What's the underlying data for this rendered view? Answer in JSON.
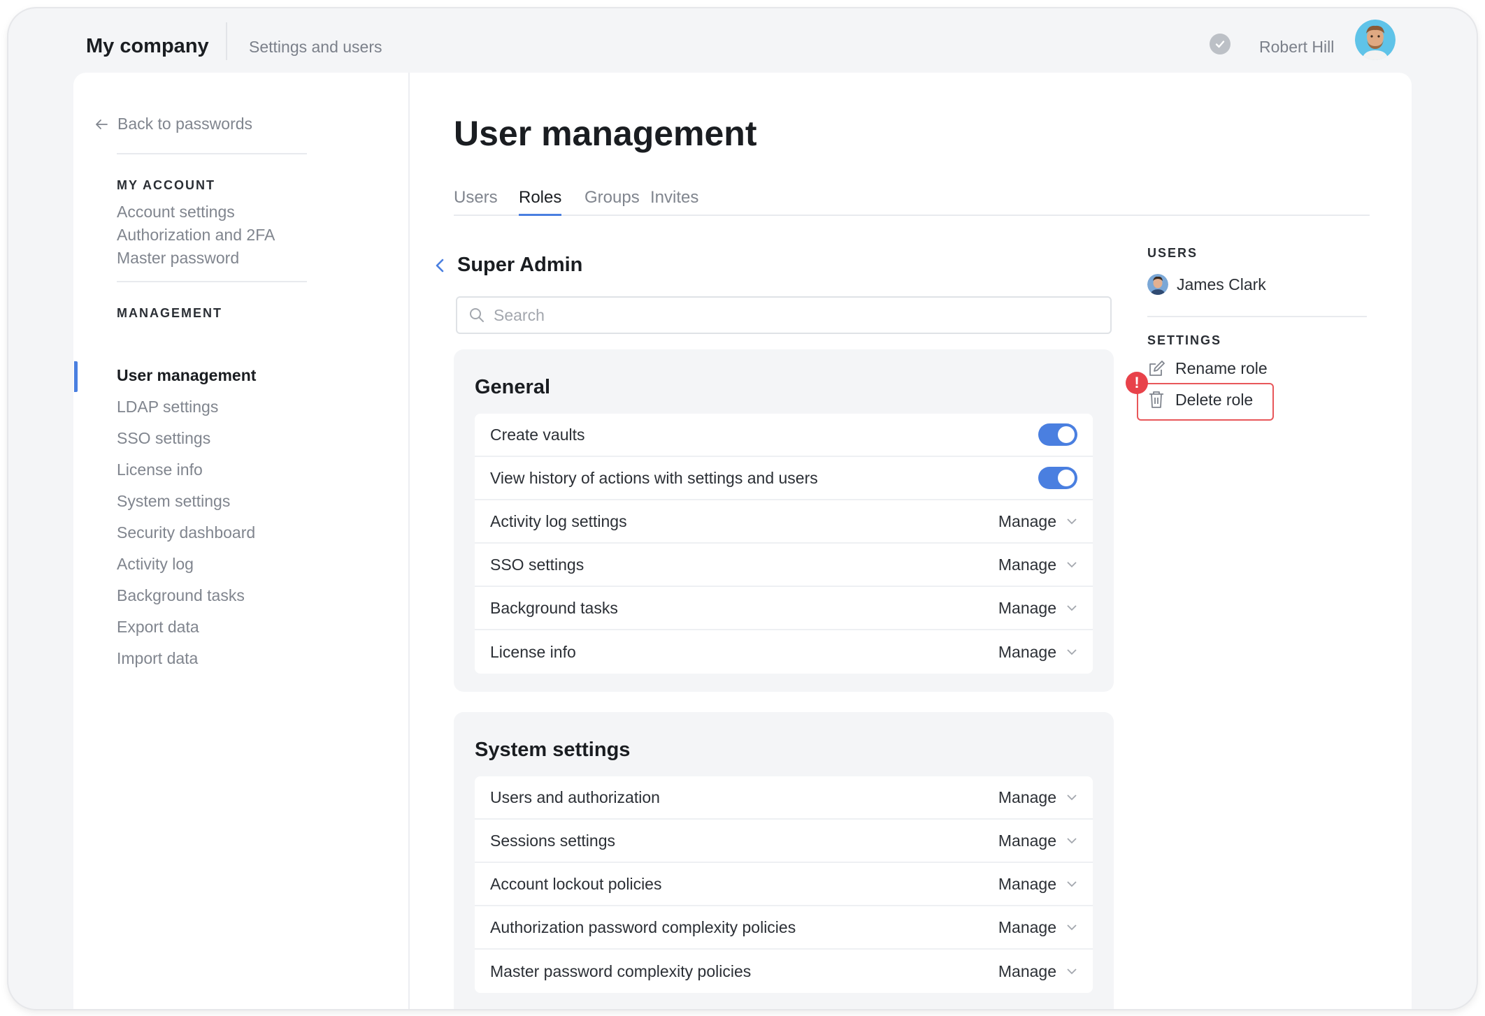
{
  "header": {
    "brand": "My company",
    "breadcrumb": "Settings and users",
    "user_name": "Robert Hill"
  },
  "sidebar": {
    "back_label": "Back to passwords",
    "my_account_title": "MY ACCOUNT",
    "my_account_items": [
      "Account settings",
      "Authorization and 2FA",
      "Master password"
    ],
    "management_title": "MANAGEMENT",
    "management_items": [
      "User management",
      "LDAP settings",
      "SSO settings",
      "License info",
      "System settings",
      "Security dashboard",
      "Activity log",
      "Background tasks",
      "Export data",
      "Import data"
    ],
    "active_item": "User management"
  },
  "main": {
    "title": "User management",
    "tabs": [
      "Users",
      "Roles",
      "Groups",
      "Invites"
    ],
    "active_tab": "Roles",
    "role_name": "Super Admin",
    "search_placeholder": "Search",
    "groups": [
      {
        "title": "General",
        "rows": [
          {
            "label": "Create vaults",
            "control": "toggle",
            "on": true
          },
          {
            "label": "View history of actions with settings and users",
            "control": "toggle",
            "on": true
          },
          {
            "label": "Activity log settings",
            "control": "select",
            "value": "Manage"
          },
          {
            "label": "SSO settings",
            "control": "select",
            "value": "Manage"
          },
          {
            "label": "Background tasks",
            "control": "select",
            "value": "Manage"
          },
          {
            "label": "License info",
            "control": "select",
            "value": "Manage"
          }
        ]
      },
      {
        "title": "System settings",
        "rows": [
          {
            "label": "Users and authorization",
            "control": "select",
            "value": "Manage"
          },
          {
            "label": "Sessions settings",
            "control": "select",
            "value": "Manage"
          },
          {
            "label": "Account lockout policies",
            "control": "select",
            "value": "Manage"
          },
          {
            "label": "Authorization password complexity policies",
            "control": "select",
            "value": "Manage"
          },
          {
            "label": "Master password complexity policies",
            "control": "select",
            "value": "Manage"
          }
        ]
      }
    ]
  },
  "right_panel": {
    "users_title": "USERS",
    "users": [
      "James Clark"
    ],
    "settings_title": "SETTINGS",
    "rename_label": "Rename role",
    "delete_label": "Delete role",
    "alert_symbol": "!"
  },
  "colors": {
    "accent": "#4a7fe0",
    "danger": "#e8424a"
  }
}
